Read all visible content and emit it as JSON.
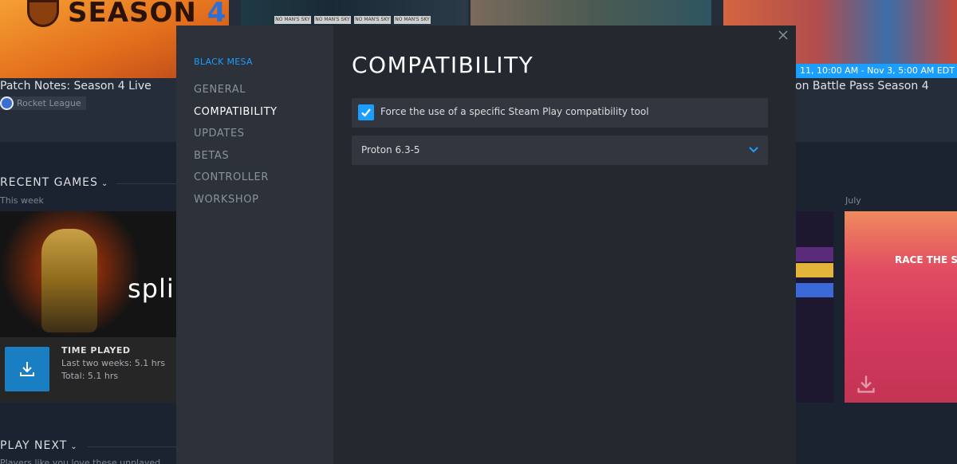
{
  "news": {
    "items": [
      {
        "title": "Patch Notes: Season 4 Live",
        "game": "Rocket League",
        "art_text": "SEASON",
        "art_num": "4"
      },
      {
        "title": "on Battle Pass Season 4",
        "date_bar": "11, 10:00 AM  - Nov 3, 5:00 AM EDT"
      }
    ],
    "tile2_strips": [
      "NO MAN'S SKY",
      "NO MAN'S SKY",
      "NO MAN'S SKY",
      "NO MAN'S SKY"
    ]
  },
  "recent_games": {
    "title": "RECENT GAMES",
    "subtitle": "This week",
    "month_label": "July",
    "featured": {
      "logo_text": "spli",
      "played_label": "TIME PLAYED",
      "last_two_weeks": "Last two weeks: 5.1 hrs",
      "total": "Total: 5.1 hrs"
    },
    "side_tile_text": "RACE THE SU"
  },
  "play_next": {
    "title": "PLAY NEXT",
    "subtitle": "Players like you love these unplayed"
  },
  "modal": {
    "game_name": "BLACK MESA",
    "nav": [
      {
        "label": "GENERAL",
        "active": false
      },
      {
        "label": "COMPATIBILITY",
        "active": true
      },
      {
        "label": "UPDATES",
        "active": false
      },
      {
        "label": "BETAS",
        "active": false
      },
      {
        "label": "CONTROLLER",
        "active": false
      },
      {
        "label": "WORKSHOP",
        "active": false
      }
    ],
    "title": "COMPATIBILITY",
    "force_tool": {
      "label": "Force the use of a specific Steam Play compatibility tool",
      "checked": true
    },
    "tool_select": {
      "value": "Proton 6.3-5"
    }
  },
  "colors": {
    "accent": "#1a9fff",
    "modal_bg": "#24282f",
    "nav_bg": "#2c313a",
    "row_bg": "#32373f"
  },
  "icons": {
    "close": "close-icon",
    "checkbox": "checkmark-icon",
    "select": "chevron-down-icon",
    "download": "download-icon"
  }
}
